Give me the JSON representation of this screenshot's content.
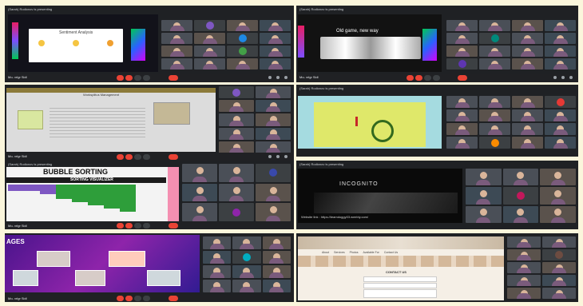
{
  "status": {
    "presenting": "(Sarah) Rodionov is presenting"
  },
  "meeting": {
    "name": "Mo- vrlgr Sidl"
  },
  "panels": {
    "p1": {
      "slide_title": "Sentiment Analysis"
    },
    "p2": {
      "slide_title": "Old game, new way"
    },
    "p3": {
      "slide_title": "Worksplitus Management"
    },
    "p5": {
      "slide_title": "BUBBLE SORTING",
      "subtitle": "SORTING VISUALIZER"
    },
    "p6": {
      "slide_title": "INCOGNITO",
      "footer": "Website link : https://teamdoggy03.weebly.com/"
    },
    "p7": {
      "slide_title": "AGES"
    },
    "p8": {
      "nav": [
        "About",
        "Services",
        "Photos",
        "Available For",
        "Contact Us"
      ],
      "form_title": "CONTACT US"
    }
  },
  "colors": {
    "end_call": "#ea4335",
    "bg": "#fbf6dc"
  }
}
